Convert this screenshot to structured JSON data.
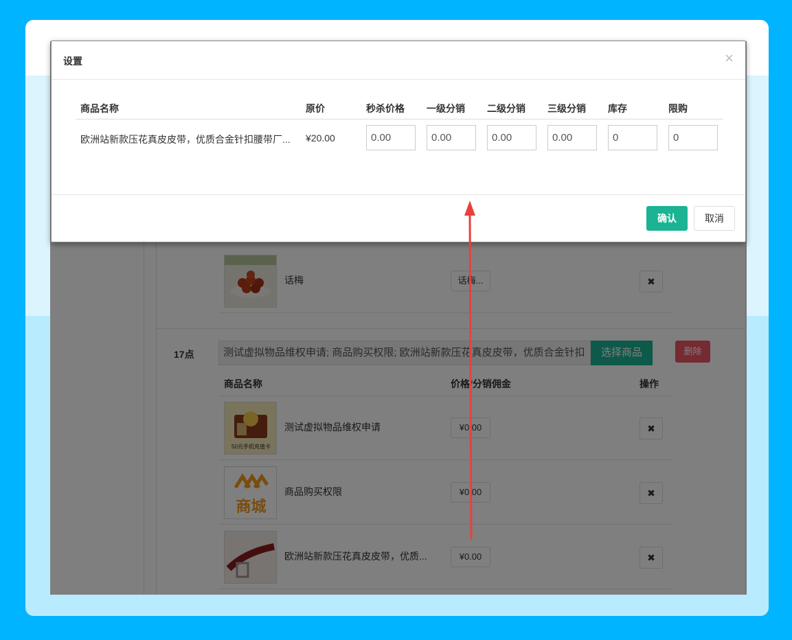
{
  "modal": {
    "title": "设置",
    "close_glyph": "×",
    "columns": [
      "商品名称",
      "原价",
      "秒杀价格",
      "一级分销",
      "二级分销",
      "三级分销",
      "库存",
      "限购"
    ],
    "row": {
      "name": "欧洲站新款压花真皮皮带，优质合金针扣腰带厂...",
      "price": "¥20.00",
      "seckill_price": "0.00",
      "level1": "0.00",
      "level2": "0.00",
      "level3": "0.00",
      "stock": "0",
      "limit": "0"
    },
    "confirm_label": "确认",
    "cancel_label": "取消"
  },
  "background": {
    "upper_row": {
      "name": "话梅",
      "price_btn": "话梅..."
    },
    "group": {
      "hour": "17点",
      "goods_input": "测试虚拟物品维权申请; 商品购买权限; 欧洲站新款压花真皮皮带，优质合金针扣",
      "select_label": "选择商品",
      "delete_label": "删除",
      "columns": [
        "商品名称",
        "价格/分销佣金",
        "操作"
      ],
      "rows": [
        {
          "name": "测试虚拟物品维权申请",
          "price": "¥0.00",
          "thumb_text": "50元手机充值卡"
        },
        {
          "name": "商品购买权限",
          "price": "¥0.00",
          "thumb_text": "商城"
        },
        {
          "name": "欧洲站新款压花真皮皮带，优质...",
          "price": "¥0.00",
          "thumb_text": ""
        }
      ],
      "remove_glyph": "✖"
    }
  },
  "colors": {
    "page_bg": "#00b4ff",
    "primary": "#1ab394",
    "danger": "#ed5565",
    "arrow": "#e8413c"
  }
}
